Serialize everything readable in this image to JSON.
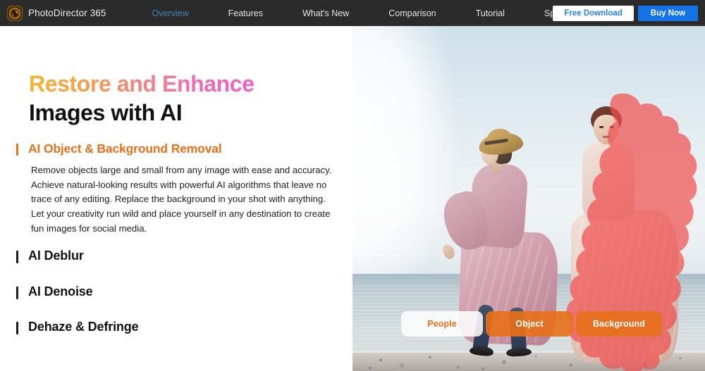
{
  "navbar": {
    "brand": "PhotoDirector 365",
    "logo_icon": "aperture-icon",
    "links": [
      {
        "label": "Overview",
        "active": true
      },
      {
        "label": "Features",
        "active": false
      },
      {
        "label": "What's New",
        "active": false
      },
      {
        "label": "Comparison",
        "active": false
      },
      {
        "label": "Tutorial",
        "active": false
      },
      {
        "label": "Specs",
        "active": false
      }
    ],
    "free_download": "Free Download",
    "buy_now": "Buy Now",
    "colors": {
      "background": "#2b2b2b",
      "active_link": "#4a7fc1",
      "free_download_text": "#2680eb",
      "buy_now_background": "#1473e6"
    }
  },
  "hero": {
    "headline_gradient": "Restore and Enhance",
    "headline_dark": "Images with AI",
    "gradient_from": "#f6b42e",
    "gradient_to": "#ee5ecb"
  },
  "accordion": {
    "items": [
      {
        "title": "AI Object & Background Removal",
        "open": true,
        "body": "Remove objects large and small from any image with ease and accuracy. Achieve natural-looking results with powerful AI algorithms that leave no trace of any editing. Replace the background in your shot with anything. Let your creativity run wild and place yourself in any destination to create fun images for social media."
      },
      {
        "title": "AI Deblur",
        "open": false,
        "body": ""
      },
      {
        "title": "AI Denoise",
        "open": false,
        "body": ""
      },
      {
        "title": "Dehaze & Defringe",
        "open": false,
        "body": ""
      }
    ],
    "active_color": "#e8701a",
    "inactive_color": "#1a1a1a"
  },
  "preview": {
    "description": "Beach photo of a woman in a straw hat and pink dress walking on a seawall, with a duplicate figure highlighted by a red AI selection mask",
    "mask_color": "#f05050",
    "tabs": [
      {
        "label": "People",
        "selected": false
      },
      {
        "label": "Object",
        "selected": true
      },
      {
        "label": "Background",
        "selected": true
      }
    ],
    "tab_active_color": "#e8701a"
  }
}
